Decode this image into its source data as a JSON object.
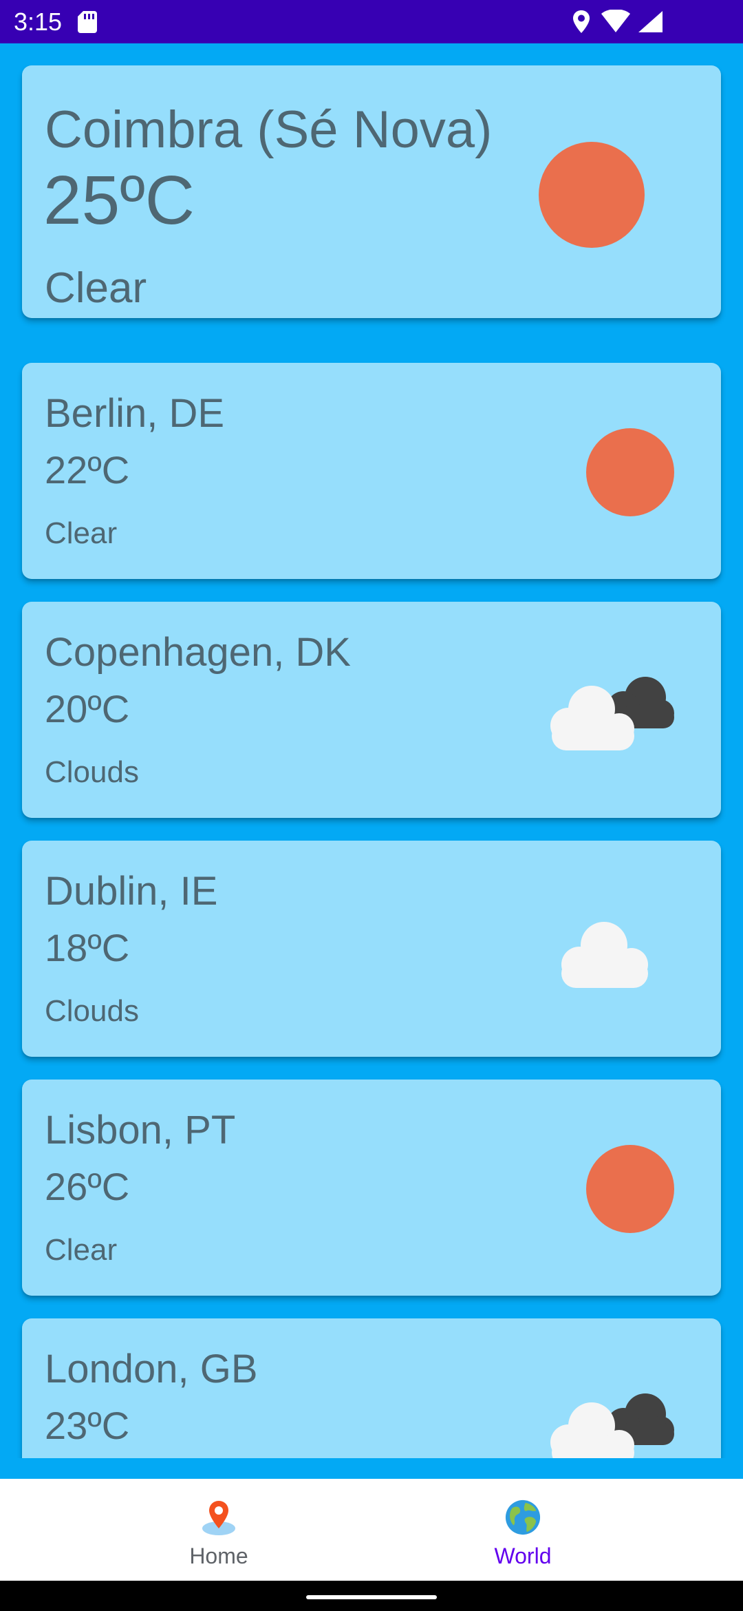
{
  "status_bar": {
    "time": "3:15",
    "icons": [
      "sd-card-icon",
      "location-icon",
      "wifi-icon",
      "signal-icon"
    ]
  },
  "current_location": {
    "city": "Coimbra (Sé Nova)",
    "temperature": "25ºC",
    "condition": "Clear",
    "icon": "sun-icon"
  },
  "cities": [
    {
      "city": "Berlin, DE",
      "temperature": "22ºC",
      "condition": "Clear",
      "icon": "sun-icon"
    },
    {
      "city": "Copenhagen, DK",
      "temperature": "20ºC",
      "condition": "Clouds",
      "icon": "dark-clouds-icon"
    },
    {
      "city": "Dublin, IE",
      "temperature": "18ºC",
      "condition": "Clouds",
      "icon": "cloud-icon"
    },
    {
      "city": "Lisbon, PT",
      "temperature": "26ºC",
      "condition": "Clear",
      "icon": "sun-icon"
    },
    {
      "city": "London, GB",
      "temperature": "23ºC",
      "condition": "",
      "icon": "dark-clouds-icon"
    }
  ],
  "bottom_nav": {
    "items": [
      {
        "label": "Home",
        "icon": "map-pin-icon",
        "selected": false
      },
      {
        "label": "World",
        "icon": "globe-icon",
        "selected": true
      }
    ]
  },
  "colors": {
    "status_bar": "#3700B3",
    "background": "#03A9F4",
    "card": "#96DEFC",
    "card_text": "#4E6773",
    "sun": "#EA6F4D",
    "nav_selected": "#6200EE",
    "nav_unselected": "#5F6368"
  }
}
